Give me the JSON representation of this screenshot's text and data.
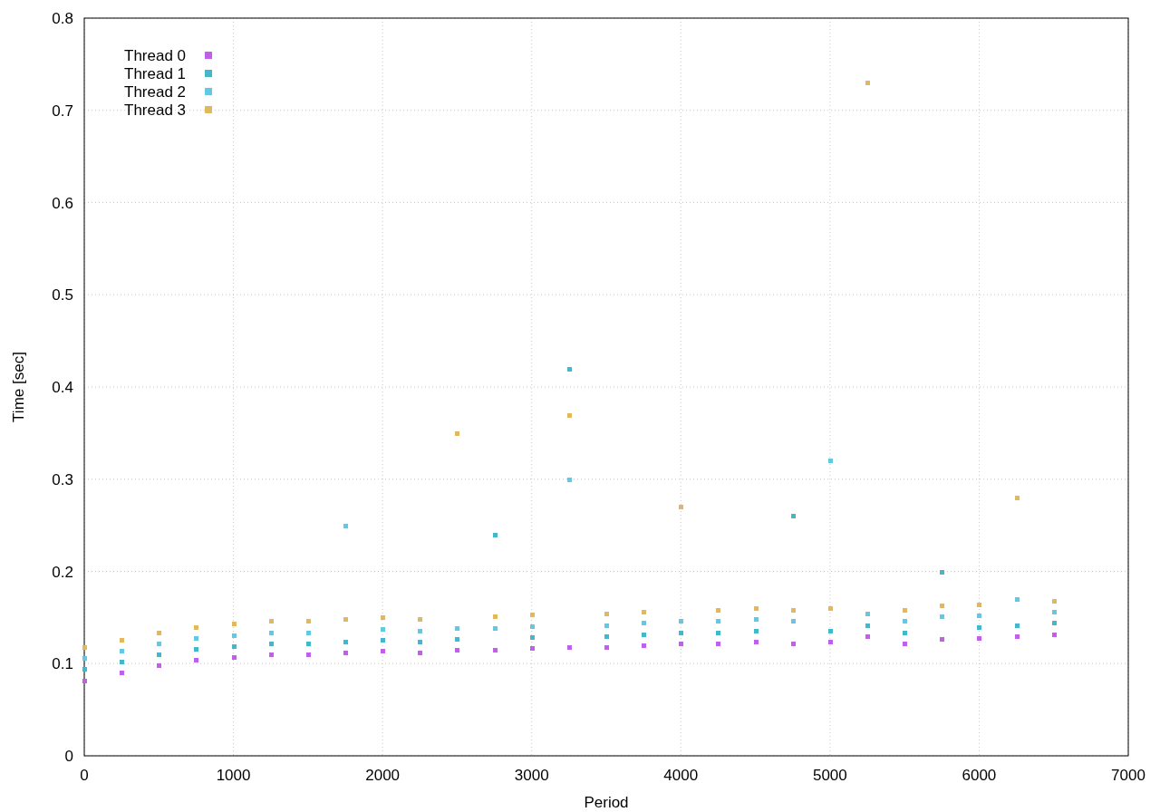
{
  "chart_data": {
    "type": "scatter",
    "xlabel": "Period",
    "ylabel": "Time [sec]",
    "x": [
      0,
      250,
      500,
      750,
      1000,
      1250,
      1500,
      1750,
      2000,
      2250,
      2500,
      2750,
      3000,
      3250,
      3500,
      3750,
      4000,
      4250,
      4500,
      4750,
      5000,
      5250,
      5500,
      5750,
      6000,
      6250,
      6500
    ],
    "series": [
      {
        "name": "Thread 0",
        "color": "#c060e8",
        "values": [
          0.082,
          0.09,
          0.098,
          0.104,
          0.107,
          0.11,
          0.11,
          0.112,
          0.114,
          0.112,
          0.115,
          0.115,
          0.117,
          0.118,
          0.118,
          0.12,
          0.122,
          0.122,
          0.124,
          0.122,
          0.124,
          0.13,
          0.122,
          0.127,
          0.128,
          0.13,
          0.132
        ]
      },
      {
        "name": "Thread 1",
        "color": "#44b8c8",
        "values": [
          0.094,
          0.102,
          0.11,
          0.116,
          0.119,
          0.122,
          0.122,
          0.124,
          0.126,
          0.124,
          0.127,
          0.24,
          0.129,
          0.42,
          0.13,
          0.132,
          0.134,
          0.134,
          0.136,
          0.26,
          0.136,
          0.142,
          0.134,
          0.2,
          0.14,
          0.142,
          0.144
        ]
      },
      {
        "name": "Thread 2",
        "color": "#66c8e0",
        "values": [
          0.106,
          0.114,
          0.122,
          0.128,
          0.131,
          0.134,
          0.134,
          0.25,
          0.138,
          0.136,
          0.139,
          0.139,
          0.141,
          0.3,
          0.142,
          0.144,
          0.146,
          0.146,
          0.148,
          0.146,
          0.32,
          0.154,
          0.146,
          0.151,
          0.152,
          0.17,
          0.156
        ]
      },
      {
        "name": "Thread 3",
        "color": "#e0b860",
        "values": [
          0.118,
          0.126,
          0.134,
          0.14,
          0.143,
          0.146,
          0.146,
          0.148,
          0.15,
          0.148,
          0.35,
          0.151,
          0.153,
          0.37,
          0.154,
          0.156,
          0.27,
          0.158,
          0.16,
          0.158,
          0.16,
          0.73,
          0.158,
          0.163,
          0.164,
          0.28,
          0.168
        ]
      }
    ],
    "grid": true,
    "legend": "top-left",
    "xlim": [
      0,
      7000
    ],
    "ylim": [
      0,
      0.8
    ],
    "xticks": [
      0,
      1000,
      2000,
      3000,
      4000,
      5000,
      6000,
      7000
    ],
    "yticks": [
      0,
      {
        "value": 0.1,
        "label": "0.1"
      },
      {
        "value": 0.2,
        "label": "0.2"
      },
      {
        "value": 0.3,
        "label": "0.3"
      },
      {
        "value": 0.4,
        "label": "0.4"
      },
      {
        "value": 0.5,
        "label": "0.5"
      },
      {
        "value": 0.6,
        "label": "0.6"
      },
      {
        "value": 0.7,
        "label": "0.7"
      },
      {
        "value": 0.8,
        "label": "0.8"
      }
    ]
  }
}
